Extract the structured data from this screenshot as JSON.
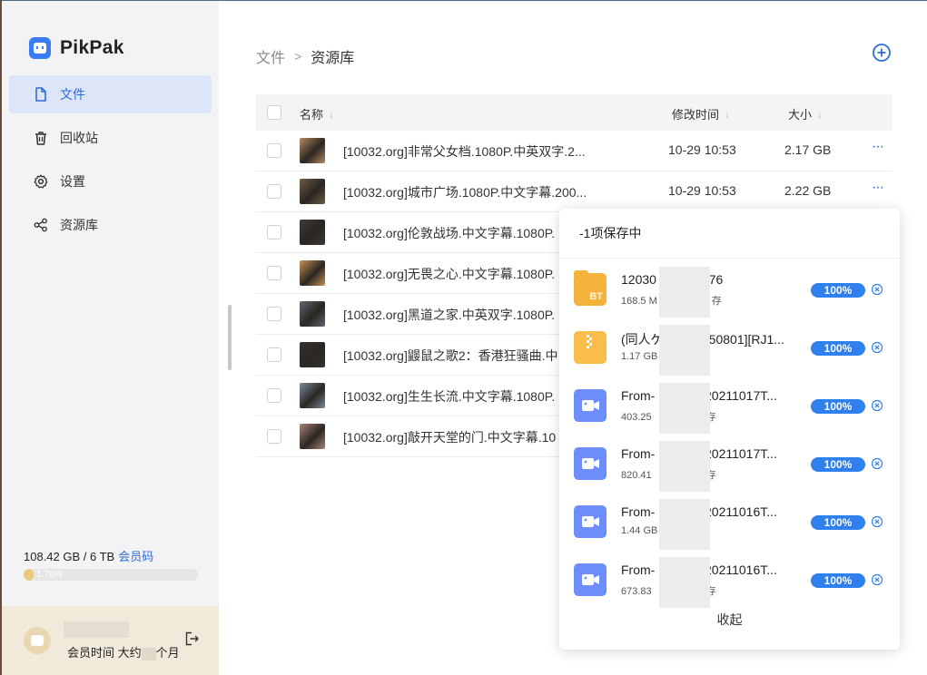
{
  "app": {
    "name": "PikPak"
  },
  "sidebar": {
    "items": [
      {
        "label": "文件",
        "icon": "file-icon",
        "active": true
      },
      {
        "label": "回收站",
        "icon": "trash-icon",
        "active": false
      },
      {
        "label": "设置",
        "icon": "gear-icon",
        "active": false
      },
      {
        "label": "资源库",
        "icon": "share-icon",
        "active": false
      }
    ],
    "storage": {
      "used_text": "108.42 GB / 6 TB",
      "member_code": "会员码",
      "percent_text": "1.76%",
      "percent": 1.76
    },
    "user": {
      "member_time_prefix": "会员时间 大约",
      "member_time_suffix": "个月"
    }
  },
  "main": {
    "breadcrumb": {
      "parent": "文件",
      "separator": ">",
      "current": "资源库"
    },
    "table": {
      "headers": {
        "name": "名称",
        "modified": "修改时间",
        "size": "大小"
      },
      "rows": [
        {
          "name": "[10032.org]非常父女档.1080P.中英双字.2...",
          "time": "10-29 10:53",
          "size": "2.17 GB",
          "thumb": "#b58a5e"
        },
        {
          "name": "[10032.org]城市广场.1080P.中文字幕.200...",
          "time": "10-29 10:53",
          "size": "2.22 GB",
          "thumb": "#6e5a44"
        },
        {
          "name": "[10032.org]伦敦战场.中文字幕.1080P.",
          "time": "",
          "size": "",
          "thumb": "#3c3a36"
        },
        {
          "name": "[10032.org]无畏之心.中文字幕.1080P.",
          "time": "",
          "size": "",
          "thumb": "#c99352"
        },
        {
          "name": "[10032.org]黑道之家.中英双字.1080P.",
          "time": "",
          "size": "",
          "thumb": "#5f6670"
        },
        {
          "name": "[10032.org]鼹鼠之歌2：香港狂骚曲.中",
          "time": "",
          "size": "",
          "thumb": "#33322e"
        },
        {
          "name": "[10032.org]生生长流.中文字幕.1080P.",
          "time": "",
          "size": "",
          "thumb": "#7a8a9a"
        },
        {
          "name": "[10032.org]敲开天堂的门.中文字幕.10",
          "time": "",
          "size": "",
          "thumb": "#a88474"
        }
      ]
    }
  },
  "popup": {
    "header": "-1项保存中",
    "collapse_label": "收起",
    "tasks": [
      {
        "name_head": "12030",
        "name_tail": "076",
        "size": "168.5 M",
        "status_tail": "存",
        "progress": "100%",
        "icon": "bt-folder-icon",
        "icon_label": "BT"
      },
      {
        "name_head": "(同人ゲ",
        "name_tail": "50801][RJ1...",
        "size": "1.17 GB",
        "status_tail": "",
        "progress": "100%",
        "icon": "zip-icon",
        "icon_label": ""
      },
      {
        "name_head": "From-",
        "name_tail": "-20211017T...",
        "size": "403.25",
        "status_tail": "存",
        "progress": "100%",
        "icon": "video-icon",
        "icon_label": ""
      },
      {
        "name_head": "From-",
        "name_tail": "-20211017T...",
        "size": "820.41",
        "status_tail": "存",
        "progress": "100%",
        "icon": "video-icon",
        "icon_label": ""
      },
      {
        "name_head": "From-",
        "name_tail": "-20211016T...",
        "size": "1.44 GB",
        "status_tail": "",
        "progress": "100%",
        "icon": "video-icon",
        "icon_label": ""
      },
      {
        "name_head": "From-",
        "name_tail": "-20211016T...",
        "size": "673.83",
        "status_tail": "存",
        "progress": "100%",
        "icon": "video-icon",
        "icon_label": ""
      }
    ]
  }
}
